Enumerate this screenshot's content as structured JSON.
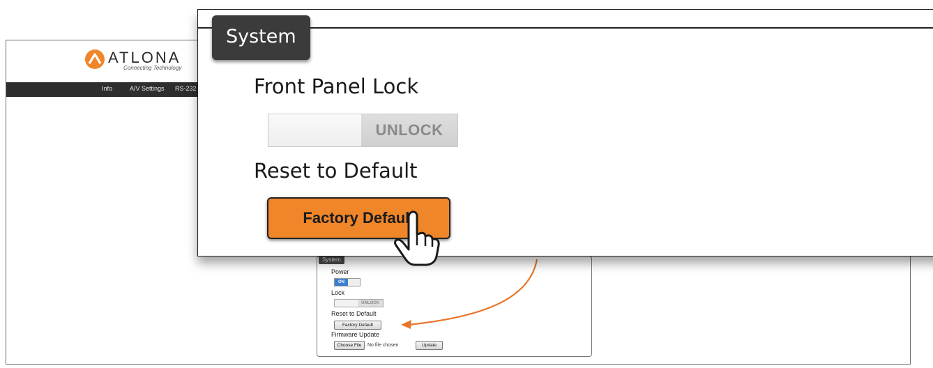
{
  "brand": {
    "name": "ATLONA",
    "tagline": "Connecting Technology",
    "accent_color": "#f0862a"
  },
  "nav": {
    "items": [
      "Info",
      "A/V Settings",
      "RS-232"
    ]
  },
  "system_small": {
    "title": "System",
    "power_label": "Power",
    "power_state": "ON",
    "lock_label": "Lock",
    "lock_state": "UNLOCK",
    "reset_label": "Reset to Default",
    "factory_button": "Factory Default",
    "firmware_label": "Firmware Update",
    "choose_file_button": "Choose File",
    "no_file_text": "No file chosen",
    "update_button": "Update"
  },
  "zoom": {
    "title": "System",
    "front_panel_label": "Front Panel Lock",
    "lock_state": "UNLOCK",
    "reset_label": "Reset to Default",
    "factory_button": "Factory Default"
  },
  "icons": [
    "atlona-logo-icon",
    "pointer-hand-icon",
    "callout-arrow-icon"
  ]
}
